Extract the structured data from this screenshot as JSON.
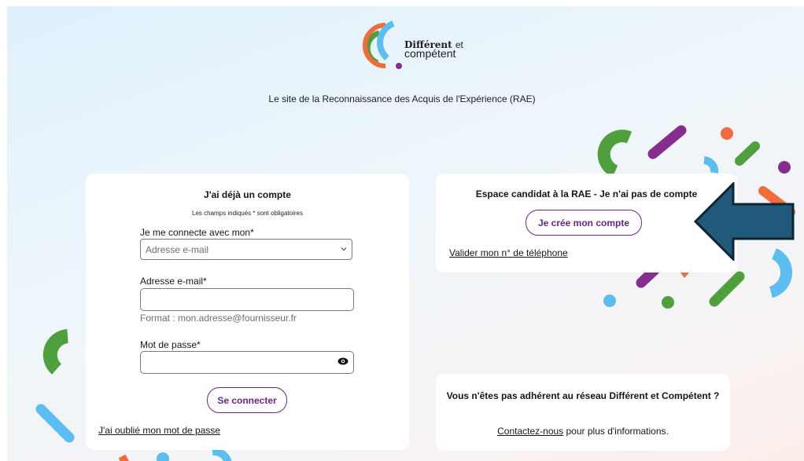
{
  "logo": {
    "line1_bold": "Différent",
    "line1_light": "et",
    "line2": "compétent"
  },
  "tagline": "Le site de la Reconnaissance des Acquis de l'Expérience (RAE)",
  "login": {
    "title": "J'ai déjà un compte",
    "required_note": "Les champs indiqués * sont obligatoires",
    "connect_with_label": "Je me connecte avec mon*",
    "connect_with_selected": "Adresse e-mail",
    "email_label": "Adresse e-mail*",
    "email_value": "",
    "email_hint": "Format : mon.adresse@fournisseur.fr",
    "password_label": "Mot de passe*",
    "password_value": "",
    "submit_label": "Se connecter",
    "forgot_link": "J'ai oublié mon mot de passe"
  },
  "signup": {
    "title": "Espace candidat à la RAE - Je n'ai pas de compte",
    "create_button": "Je crée mon compte",
    "phone_link": "Valider mon n° de téléphone"
  },
  "contact": {
    "title": "Vous n'êtes pas adhérent au réseau Différent et Compétent ?",
    "link": "Contactez-nous",
    "suffix": " pour plus d'informations."
  },
  "icons": {
    "select": "chevron-down-icon",
    "password": "eye-icon",
    "pointer": "arrow-left-icon"
  },
  "colors": {
    "accent_purple": "#6c2585",
    "green": "#4f9f3c",
    "orange": "#f26b3a",
    "light_blue": "#5bbdf0",
    "arrow_blue": "#1f5a7a"
  }
}
